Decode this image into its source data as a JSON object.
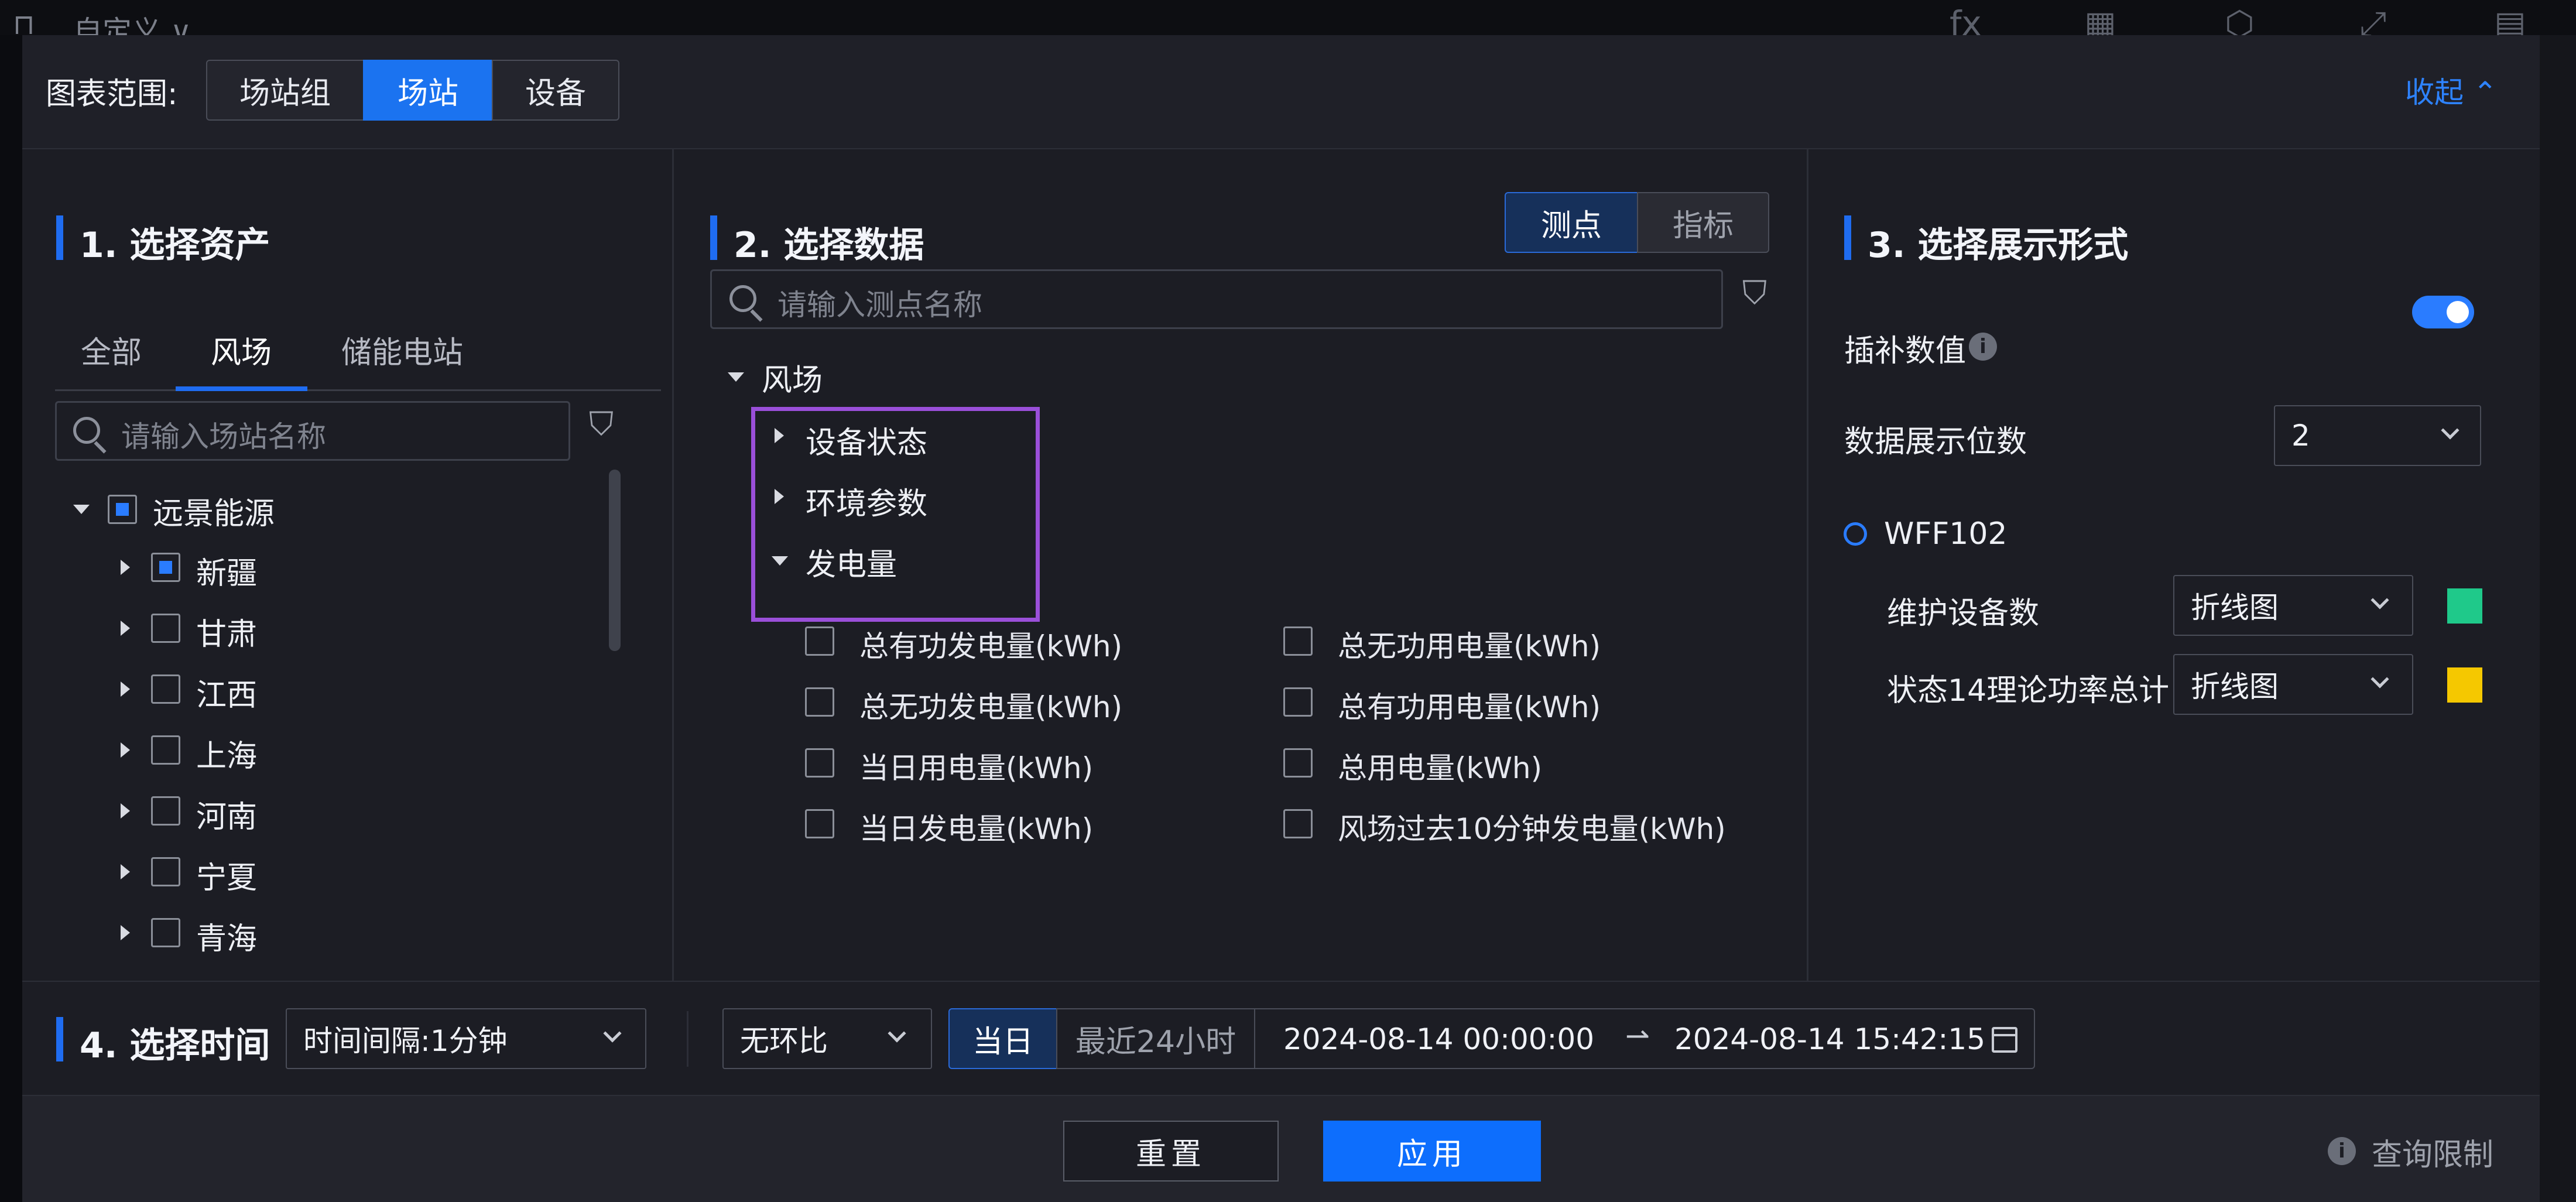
{
  "background": {
    "title": "自定义",
    "icons": [
      "fx-icon",
      "table-icon",
      "settings-shield-icon",
      "expand-icon",
      "export-icon"
    ]
  },
  "header": {
    "scope_label": "图表范围:",
    "scope_options": [
      "场站组",
      "场站",
      "设备"
    ],
    "scope_selected": "场站",
    "collapse_label": "收起"
  },
  "section1": {
    "title": "1. 选择资产",
    "tabs": [
      "全部",
      "风场",
      "储能电站"
    ],
    "active_tab": "风场",
    "search_placeholder": "请输入场站名称",
    "tree": {
      "root": {
        "label": "远景能源",
        "state": "partial"
      },
      "children": [
        {
          "label": "新疆",
          "state": "partial"
        },
        {
          "label": "甘肃",
          "state": "unchecked"
        },
        {
          "label": "江西",
          "state": "unchecked"
        },
        {
          "label": "上海",
          "state": "unchecked"
        },
        {
          "label": "河南",
          "state": "unchecked"
        },
        {
          "label": "宁夏",
          "state": "unchecked"
        },
        {
          "label": "青海",
          "state": "unchecked"
        }
      ]
    }
  },
  "section2": {
    "title": "2. 选择数据",
    "toggle": [
      "测点",
      "指标"
    ],
    "toggle_selected": "测点",
    "search_placeholder": "请输入测点名称",
    "tree": {
      "root": "风场",
      "groups": [
        "设备状态",
        "环境参数",
        "发电量"
      ],
      "expanded_group": "发电量",
      "leaves_left": [
        "总有功发电量(kWh)",
        "总无功发电量(kWh)",
        "当日用电量(kWh)",
        "当日发电量(kWh)"
      ],
      "leaves_right": [
        "总无功用电量(kWh)",
        "总有功用电量(kWh)",
        "总用电量(kWh)",
        "风场过去10分钟发电量(kWh)"
      ]
    }
  },
  "section3": {
    "title": "3. 选择展示形式",
    "interp_label": "插补数值",
    "interp_on": true,
    "digits_label": "数据展示位数",
    "digits_value": "2",
    "device_name": "WFF102",
    "metrics": [
      {
        "label": "维护设备数",
        "chart": "折线图",
        "color": "#1fc98a"
      },
      {
        "label": "状态14理论功率总计",
        "chart": "折线图",
        "color": "#f5c800"
      }
    ]
  },
  "section4": {
    "title": "4. 选择时间",
    "interval": "时间间隔:1分钟",
    "compare": "无环比",
    "range_options": [
      "当日",
      "最近24小时"
    ],
    "range_selected": "当日",
    "start": "2024-08-14 00:00:00",
    "arrow": "⇀",
    "end": "2024-08-14 15:42:15"
  },
  "footer": {
    "reset": "重置",
    "apply": "应用",
    "limit": "查询限制"
  }
}
